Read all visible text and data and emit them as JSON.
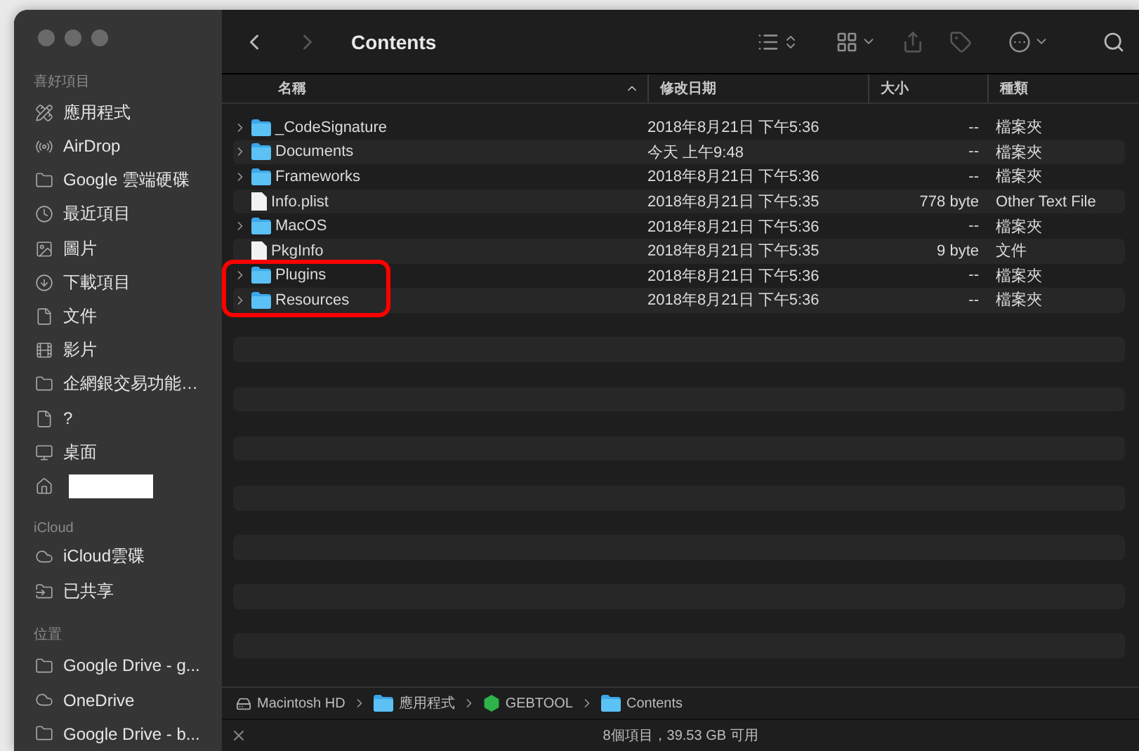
{
  "window": {
    "title": "Contents"
  },
  "sidebar": {
    "sections": [
      {
        "heading": "喜好項目",
        "items": [
          {
            "kind": "apps",
            "label": "應用程式"
          },
          {
            "kind": "airdrop",
            "label": "AirDrop"
          },
          {
            "kind": "folder",
            "label": "Google 雲端硬碟"
          },
          {
            "kind": "recent",
            "label": "最近項目"
          },
          {
            "kind": "pictures",
            "label": "圖片"
          },
          {
            "kind": "downloads",
            "label": "下載項目"
          },
          {
            "kind": "document",
            "label": "文件"
          },
          {
            "kind": "movies",
            "label": "影片"
          },
          {
            "kind": "folder",
            "label": "企網銀交易功能…"
          },
          {
            "kind": "document",
            "label": "?"
          },
          {
            "kind": "desktop",
            "label": "桌面"
          },
          {
            "kind": "home",
            "redacted": true
          }
        ]
      },
      {
        "heading": "iCloud",
        "items": [
          {
            "kind": "cloud",
            "label": "iCloud雲碟"
          },
          {
            "kind": "shared",
            "label": "已共享"
          }
        ]
      },
      {
        "heading": "位置",
        "items": [
          {
            "kind": "folder",
            "label": "Google Drive - g..."
          },
          {
            "kind": "cloud",
            "label": "OneDrive"
          },
          {
            "kind": "folder",
            "label": "Google Drive - b..."
          }
        ]
      }
    ]
  },
  "table": {
    "columns": [
      "名稱",
      "修改日期",
      "大小",
      "種類"
    ],
    "rows": [
      {
        "kind": "folder",
        "name": "_CodeSignature",
        "date": "2018年8月21日 下午5:36",
        "size": "--",
        "type": "檔案夾",
        "annotated": false
      },
      {
        "kind": "folder",
        "name": "Documents",
        "date": "今天 上午9:48",
        "size": "--",
        "type": "檔案夾",
        "annotated": false
      },
      {
        "kind": "folder",
        "name": "Frameworks",
        "date": "2018年8月21日 下午5:36",
        "size": "--",
        "type": "檔案夾",
        "annotated": false
      },
      {
        "kind": "file",
        "name": "Info.plist",
        "date": "2018年8月21日 下午5:35",
        "size": "778 byte",
        "type": "Other Text File",
        "annotated": false
      },
      {
        "kind": "folder",
        "name": "MacOS",
        "date": "2018年8月21日 下午5:36",
        "size": "--",
        "type": "檔案夾",
        "annotated": false
      },
      {
        "kind": "file",
        "name": "PkgInfo",
        "date": "2018年8月21日 下午5:35",
        "size": "9 byte",
        "type": "文件",
        "annotated": false
      },
      {
        "kind": "folder",
        "name": "Plugins",
        "date": "2018年8月21日 下午5:36",
        "size": "--",
        "type": "檔案夾",
        "annotated": true
      },
      {
        "kind": "folder",
        "name": "Resources",
        "date": "2018年8月21日 下午5:36",
        "size": "--",
        "type": "檔案夾",
        "annotated": true
      }
    ]
  },
  "path_bar": [
    {
      "kind": "disk",
      "label": "Macintosh HD"
    },
    {
      "kind": "apps",
      "label": "應用程式"
    },
    {
      "kind": "app",
      "label": "GEBTOOL"
    },
    {
      "kind": "folder",
      "label": "Contents"
    }
  ],
  "status_bar": "8個項目，39.53 GB 可用"
}
